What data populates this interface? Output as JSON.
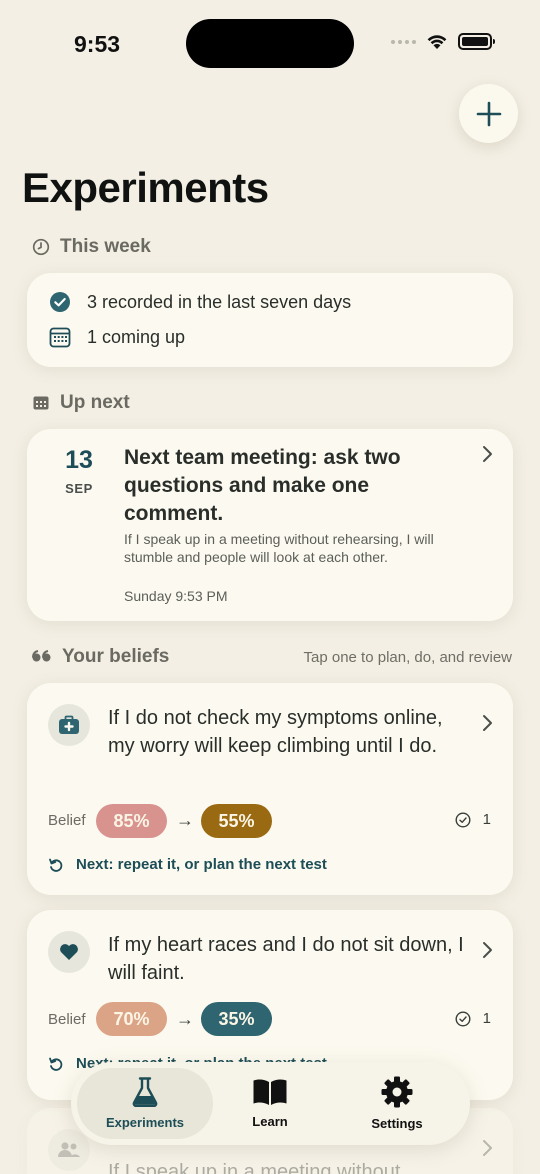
{
  "status": {
    "time": "9:53"
  },
  "header": {
    "title": "Experiments"
  },
  "this_week": {
    "header": "This week",
    "recorded": "3 recorded in the last seven days",
    "upcoming": "1 coming up"
  },
  "up_next": {
    "header": "Up next",
    "day": "13",
    "month": "SEP",
    "title": "Next team meeting: ask two questions and make one comment.",
    "description": "If I speak up in a meeting without rehearsing, I will stumble and people will look at each other.",
    "time": "Sunday 9:53 PM"
  },
  "beliefs": {
    "header": "Your beliefs",
    "hint": "Tap one to plan, do, and review",
    "items": [
      {
        "text": "If I do not check my symptoms online, my worry will keep climbing until I do.",
        "belief_label": "Belief",
        "before": "85%",
        "after": "55%",
        "before_color": "#d8938f",
        "after_color": "#9a6a12",
        "count": "1",
        "next": "Next: repeat it, or plan the next test"
      },
      {
        "text": "If my heart races and I do not sit down, I will faint.",
        "belief_label": "Belief",
        "before": "70%",
        "after": "35%",
        "before_color": "#dca486",
        "after_color": "#2f6570",
        "count": "1",
        "next": "Next: repeat it, or plan the next test"
      },
      {
        "text": "If I speak up in a meeting without"
      }
    ]
  },
  "tabs": {
    "experiments": "Experiments",
    "learn": "Learn",
    "settings": "Settings"
  },
  "colors": {
    "accent": "#1d4d56",
    "background": "#f3efe4",
    "card": "#fcfaf0"
  }
}
